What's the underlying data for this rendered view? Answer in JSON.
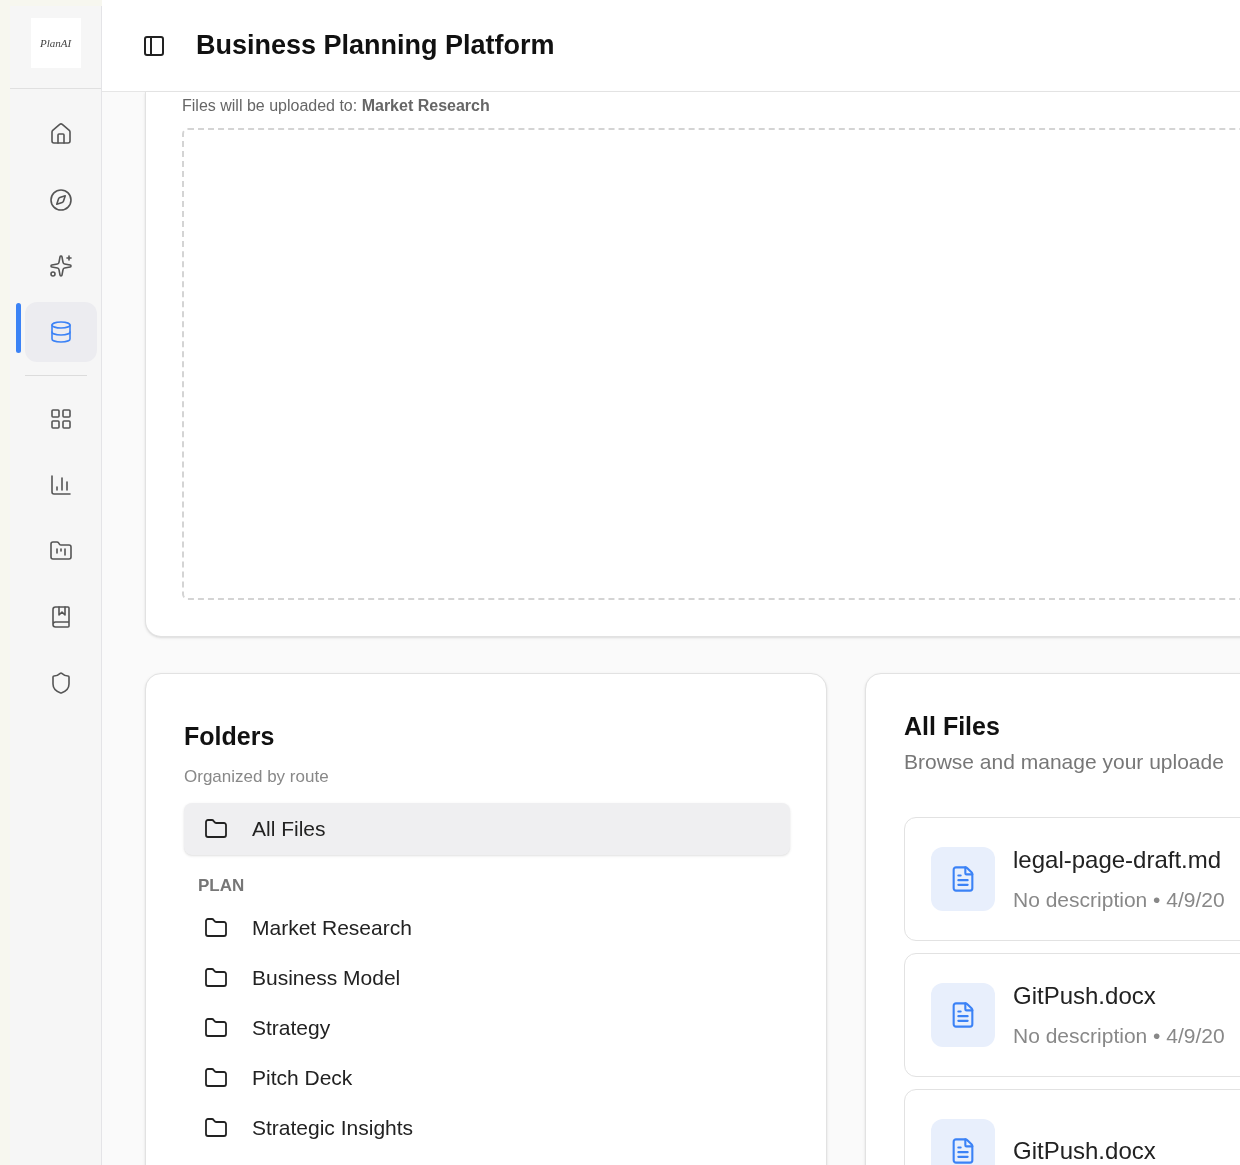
{
  "app": {
    "logo": "PlanAI",
    "title": "Business Planning Platform"
  },
  "nav": [
    {
      "kind": "home",
      "selected": false
    },
    {
      "kind": "compass",
      "selected": false
    },
    {
      "kind": "sparkles",
      "selected": false
    },
    {
      "kind": "database",
      "selected": true
    },
    {
      "kind": "divider"
    },
    {
      "kind": "grid",
      "selected": false
    },
    {
      "kind": "chart",
      "selected": false
    },
    {
      "kind": "folder",
      "selected": false
    },
    {
      "kind": "book",
      "selected": false
    },
    {
      "kind": "shield",
      "selected": false
    }
  ],
  "upload": {
    "destination_note": "Files will be uploaded to: **Market Research**"
  },
  "folders": {
    "title": "Folders",
    "subtitle": "Organized by route",
    "all_files": {
      "label": "All Files",
      "selected": true
    },
    "groups": [
      {
        "heading": "PLAN",
        "items": [
          {
            "label": "Market Research",
            "selected": false
          },
          {
            "label": "Business Model",
            "selected": false
          },
          {
            "label": "Strategy",
            "selected": false
          },
          {
            "label": "Pitch Deck",
            "selected": false
          },
          {
            "label": "Strategic Insights",
            "selected": false
          }
        ]
      }
    ]
  },
  "files": {
    "title": "All Files",
    "subtitle": "Browse and manage your uploade",
    "items": [
      {
        "name": "legal-page-draft.md",
        "meta": "No description • 4/9/20"
      },
      {
        "name": "GitPush.docx",
        "meta": "No description • 4/9/20"
      },
      {
        "name": "GitPush.docx"
      }
    ]
  }
}
